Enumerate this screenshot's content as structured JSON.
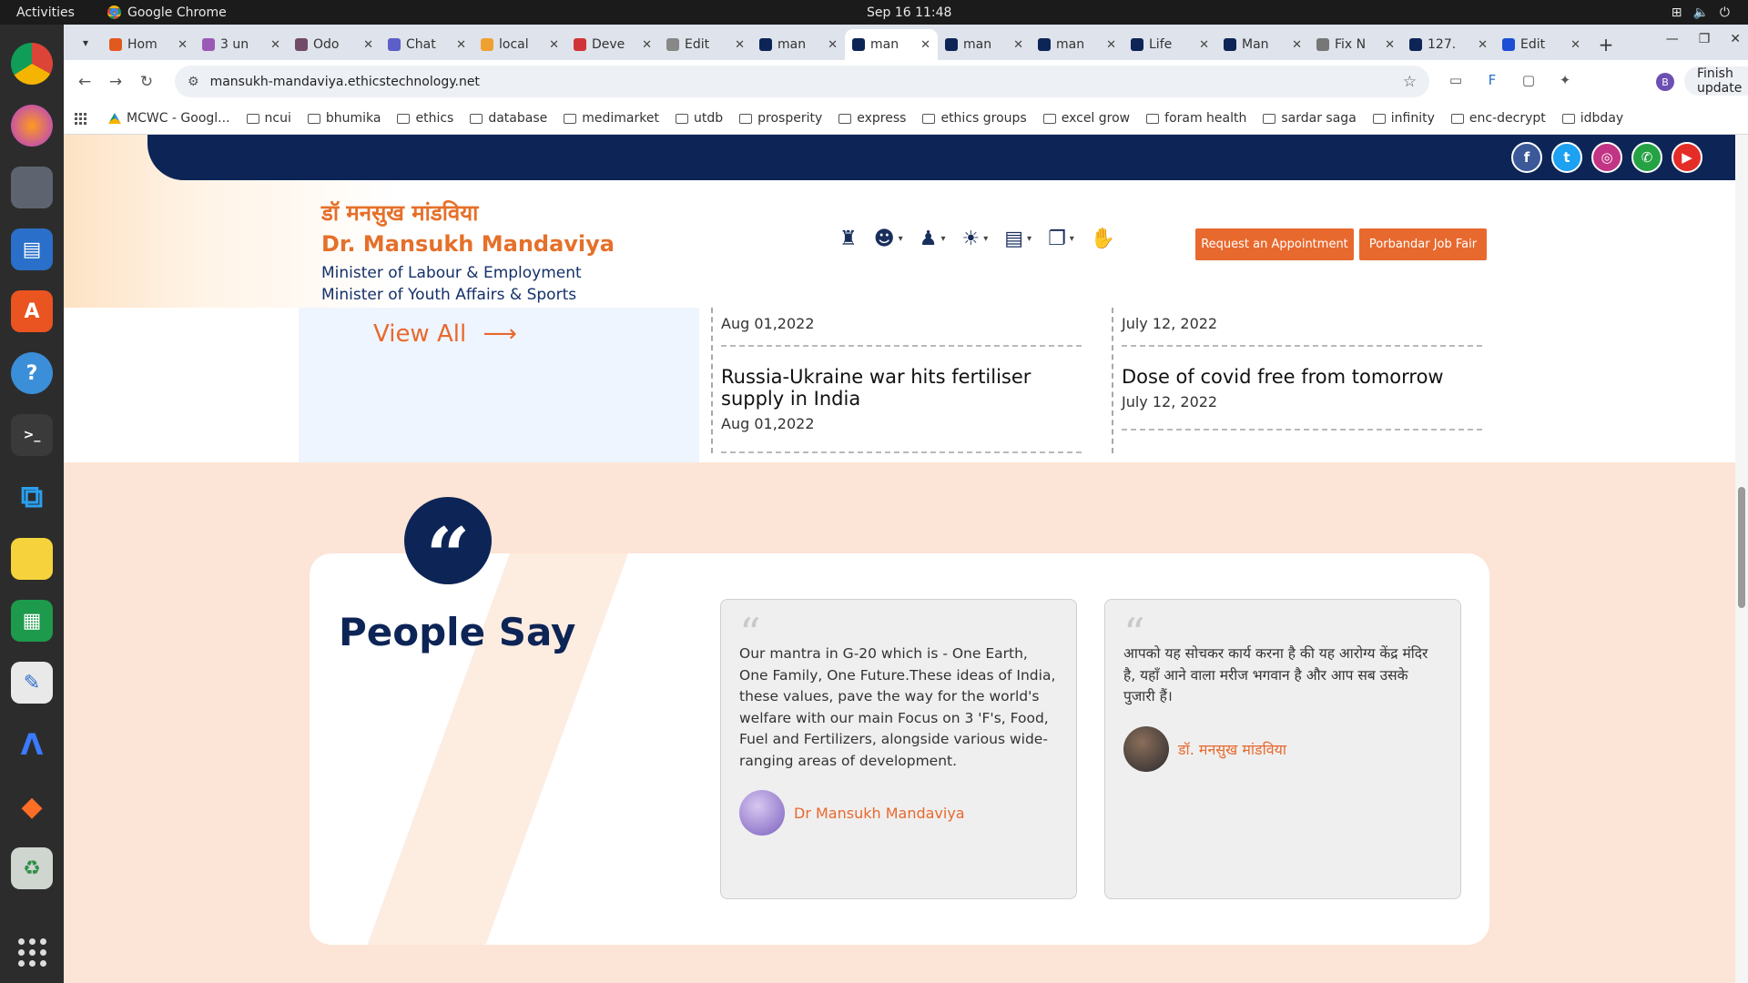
{
  "system": {
    "activities": "Activities",
    "app_name": "Google Chrome",
    "clock": "Sep 16  11:48"
  },
  "browser": {
    "tabs": [
      {
        "title": "Hom",
        "color": "#e2591f"
      },
      {
        "title": "3 un",
        "color": "#9b59b6"
      },
      {
        "title": "Odo",
        "color": "#714b67"
      },
      {
        "title": "Chat",
        "color": "#5b5fc7"
      },
      {
        "title": "local",
        "color": "#f0a030"
      },
      {
        "title": "Deve",
        "color": "#d13438"
      },
      {
        "title": "Edit",
        "color": "#888888"
      },
      {
        "title": "man",
        "color": "#0d2556"
      },
      {
        "title": "man",
        "color": "#0d2556",
        "active": true
      },
      {
        "title": "man",
        "color": "#0d2556"
      },
      {
        "title": "man",
        "color": "#0d2556"
      },
      {
        "title": "Life",
        "color": "#0d2556"
      },
      {
        "title": "Man",
        "color": "#0d2556"
      },
      {
        "title": "Fix N",
        "color": "#777777"
      },
      {
        "title": "127.",
        "color": "#0d2556"
      },
      {
        "title": "Edit",
        "color": "#1a4fd6"
      }
    ],
    "url": "mansukh-mandaviya.ethicstechnology.net",
    "profile_initial": "B",
    "finish_update": "Finish update",
    "bookmarks": [
      "MCWC - Googl...",
      "ncui",
      "bhumika",
      "ethics",
      "database",
      "medimarket",
      "utdb",
      "prosperity",
      "express",
      "ethics groups",
      "excel grow",
      "foram health",
      "sardar saga",
      "infinity",
      "enc-decrypt",
      "idbday"
    ]
  },
  "site": {
    "name_hi": "डॉ मनसुख मांडविया",
    "name_en": "Dr. Mansukh Mandaviya",
    "role1": "Minister of Labour & Employment",
    "role2": "Minister of Youth Affairs & Sports",
    "btn_appointment": "Request an Appointment",
    "btn_jobfair": "Porbandar Job Fair",
    "social": [
      "facebook-icon",
      "twitter-icon",
      "instagram-icon",
      "whatsapp-icon",
      "youtube-icon"
    ],
    "colors": {
      "navy": "#0d2556",
      "orange": "#e8692e"
    }
  },
  "news": {
    "view_all": "View All",
    "left": [
      {
        "date": "Aug 01,2022"
      },
      {
        "headline": "Russia-Ukraine war hits fertiliser supply in India",
        "date": "Aug 01,2022"
      }
    ],
    "right": [
      {
        "date": "July 12, 2022"
      },
      {
        "headline": "Dose of covid free from tomorrow",
        "date": "July 12, 2022"
      }
    ]
  },
  "people_say": {
    "title": "People Say",
    "testimonials": [
      {
        "text": "Our mantra in G-20 which is - One Earth, One Family, One Future.These ideas of India, these values, pave the way for the world's welfare with our main Focus on 3 'F's, Food, Fuel and Fertilizers, alongside various wide-ranging areas of development.",
        "author": "Dr Mansukh Mandaviya"
      },
      {
        "text": "आपको यह सोचकर कार्य करना है की यह आरोग्य केंद्र मंदिर है, यहाँ आने वाला मरीज भगवान है और आप सब उसके पुजारी हैं।",
        "author": "डॉ. मनसुख मांडविया"
      }
    ]
  }
}
